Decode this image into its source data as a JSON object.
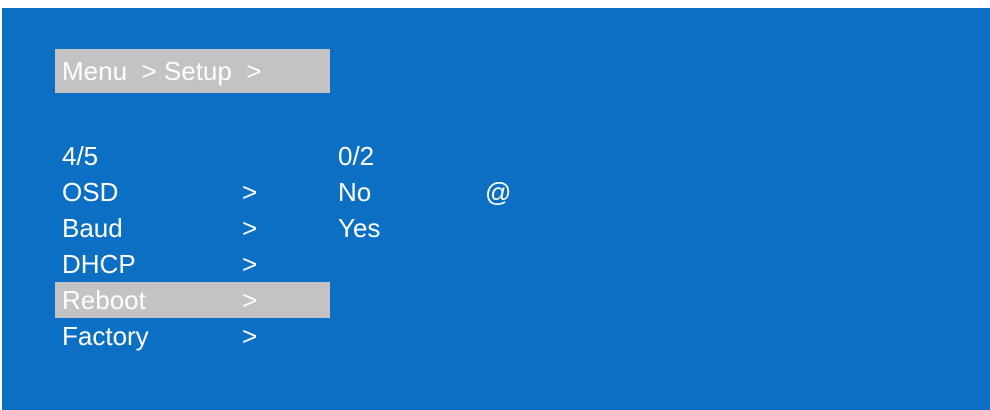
{
  "breadcrumb": {
    "text": "Menu  > Setup  >"
  },
  "left_pager": "4/5",
  "right_pager": "0/2",
  "menu_items": [
    {
      "label": "OSD",
      "arrow": ">"
    },
    {
      "label": "Baud",
      "arrow": ">"
    },
    {
      "label": "DHCP",
      "arrow": ">"
    },
    {
      "label": "Reboot",
      "arrow": ">"
    },
    {
      "label": "Factory",
      "arrow": ">"
    }
  ],
  "selected_index": 3,
  "options": [
    "No",
    "Yes"
  ],
  "current_option_marker": "@",
  "colors": {
    "background": "#0b70c3",
    "highlight": "#c3c3c3",
    "text": "#ffffff"
  }
}
